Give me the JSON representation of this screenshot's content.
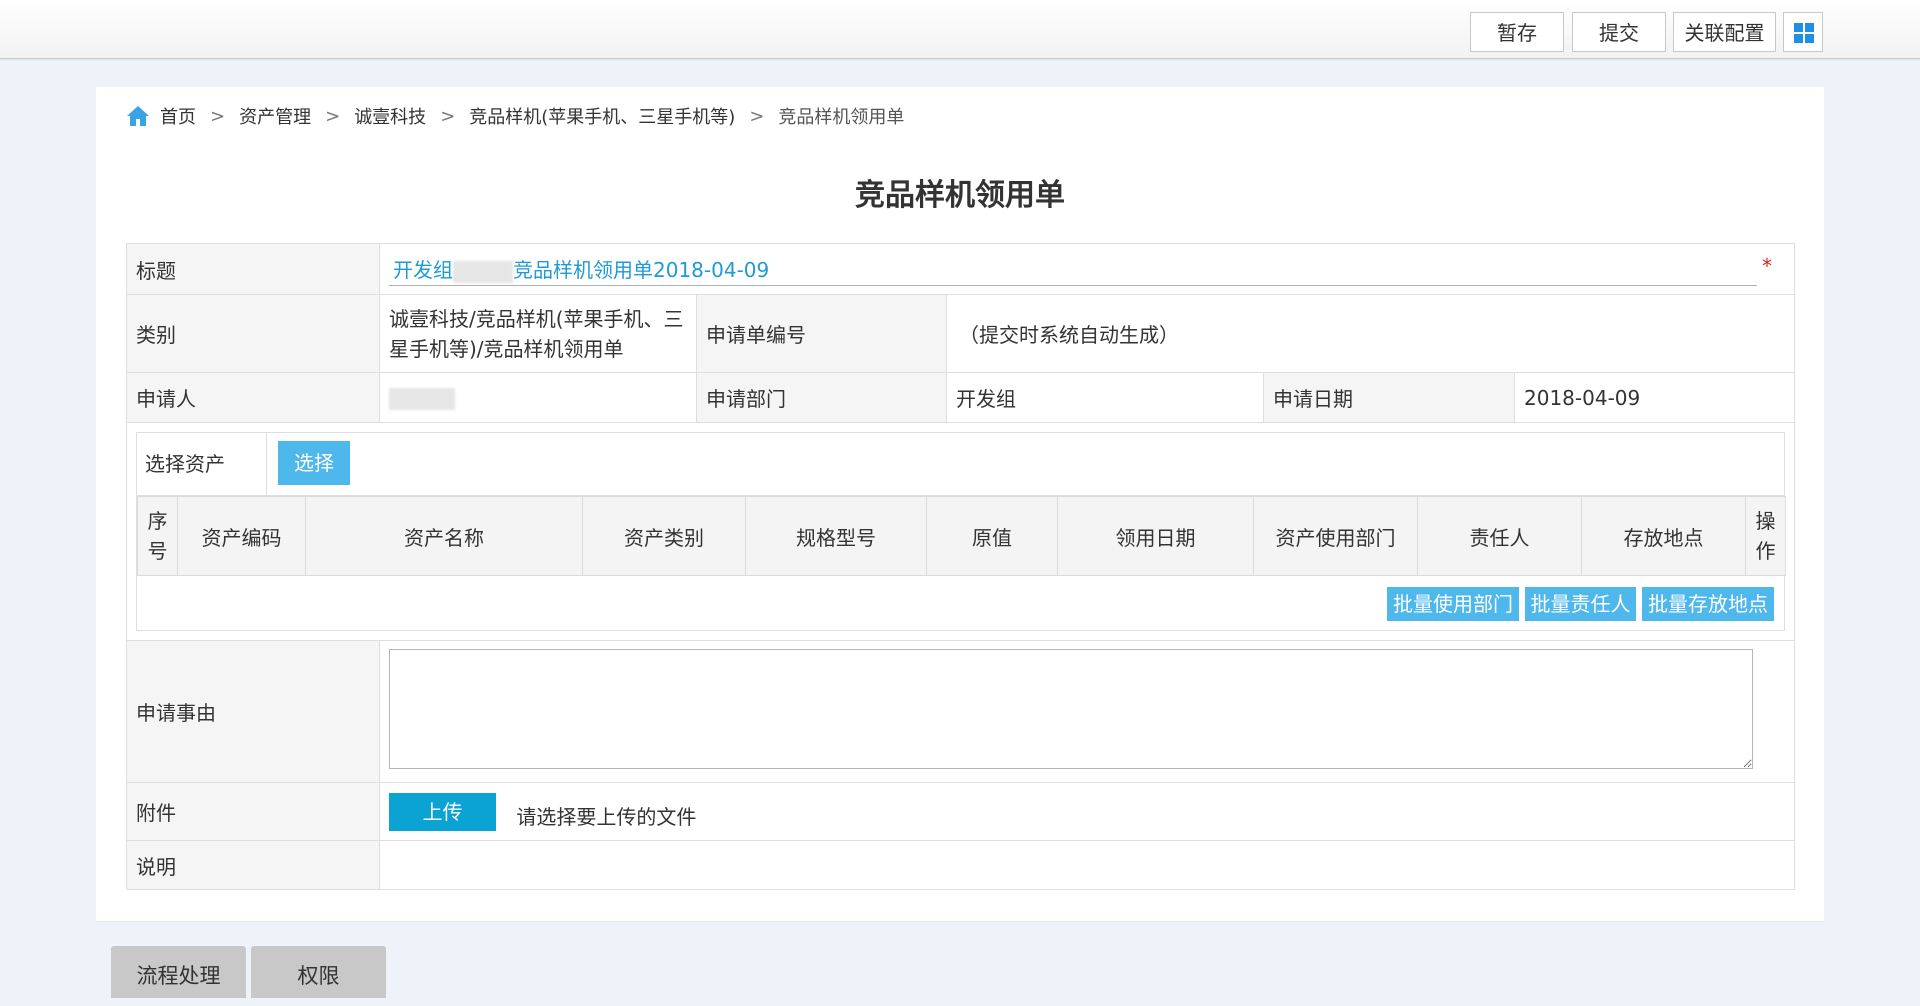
{
  "toolbar": {
    "save_draft": "暂存",
    "submit": "提交",
    "link_config": "关联配置"
  },
  "breadcrumb": {
    "home": "首页",
    "items": [
      "资产管理",
      "诚壹科技",
      "竞品样机(苹果手机、三星手机等)",
      "竞品样机领用单"
    ]
  },
  "page_title": "竞品样机领用单",
  "form": {
    "title_label": "标题",
    "title_prefix": "开发组",
    "title_suffix": "竞品样机领用单2018-04-09",
    "required_mark": "*",
    "category_label": "类别",
    "category_value": "诚壹科技/竞品样机(苹果手机、三星手机等)/竞品样机领用单",
    "app_no_label": "申请单编号",
    "app_no_value": "（提交时系统自动生成）",
    "applicant_label": "申请人",
    "dept_label": "申请部门",
    "dept_value": "开发组",
    "date_label": "申请日期",
    "date_value": "2018-04-09",
    "asset_select_label": "选择资产",
    "asset_select_button": "选择",
    "asset_columns": [
      "序号",
      "资产编码",
      "资产名称",
      "资产类别",
      "规格型号",
      "原值",
      "领用日期",
      "资产使用部门",
      "责任人",
      "存放地点",
      "操作"
    ],
    "batch_dept": "批量使用部门",
    "batch_owner": "批量责任人",
    "batch_location": "批量存放地点",
    "reason_label": "申请事由",
    "reason_value": "",
    "attachment_label": "附件",
    "upload_button": "上传",
    "upload_hint": "请选择要上传的文件",
    "note_label": "说明",
    "note_value": ""
  },
  "bottom_tabs": [
    "流程处理",
    "权限"
  ],
  "colors": {
    "accent": "#4eb7ec",
    "upload": "#0ba2d4",
    "title_text": "#1e9bd7",
    "background": "#eef3f9"
  }
}
